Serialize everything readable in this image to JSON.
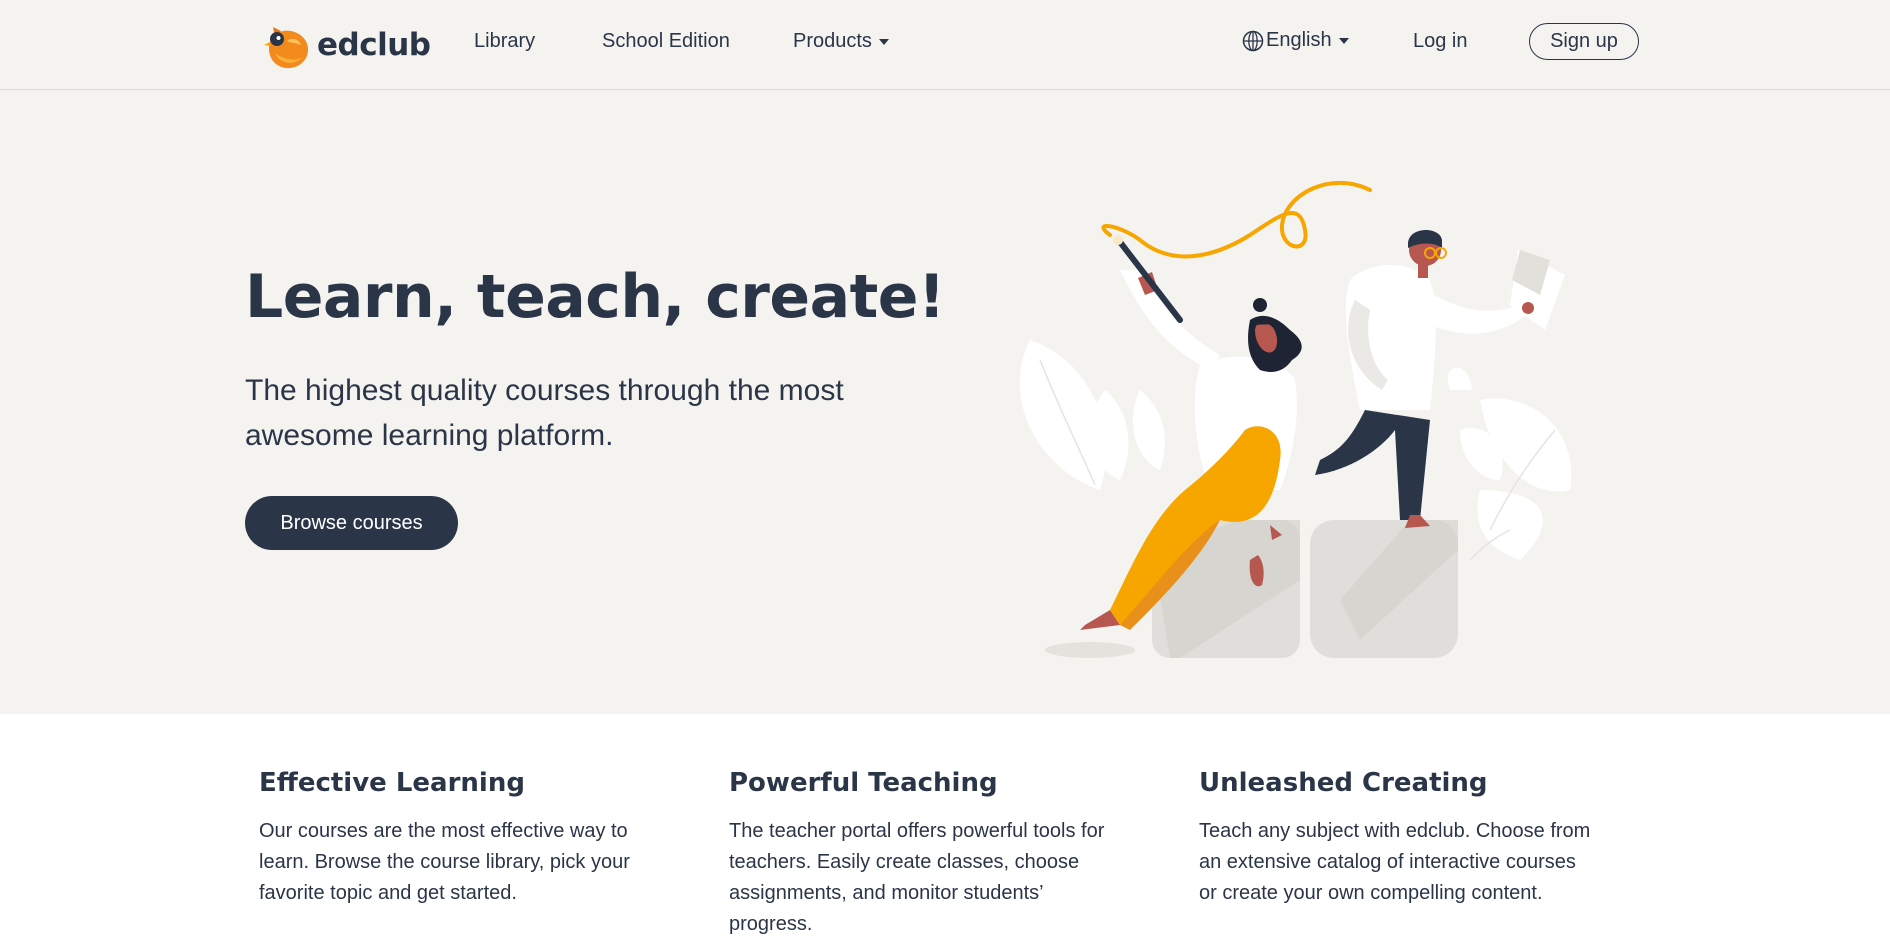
{
  "nav": {
    "logo_text": "edclub",
    "links": [
      "Library",
      "School Edition",
      "Products"
    ],
    "language": "English",
    "login": "Log in",
    "signup": "Sign up"
  },
  "hero": {
    "title": "Learn, teach, create!",
    "subtitle": "The highest quality courses through the most awesome learning platform.",
    "cta": "Browse courses"
  },
  "features": [
    {
      "title": "Effective Learning",
      "text": "Our courses are the most effective way to learn. Browse the course library, pick your favorite topic and get started."
    },
    {
      "title": "Powerful Teaching",
      "text": "The teacher portal offers powerful tools for teachers. Easily create classes, choose assignments, and monitor students’ progress."
    },
    {
      "title": "Unleashed Creating",
      "text": "Teach any subject with edclub. Choose from an extensive catalog of interactive courses or create your own compelling content."
    }
  ],
  "icons": {
    "logo": "bird-logo-icon",
    "language": "globe-icon",
    "dropdown": "caret-down-icon"
  },
  "colors": {
    "primary": "#2b3548",
    "hero_bg": "#f4f3f0",
    "accent": "#f7a600"
  }
}
